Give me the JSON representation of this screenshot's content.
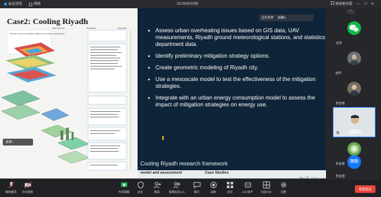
{
  "topbar": {
    "meeting_info": "会议详情",
    "meeting_id": "",
    "signal": "网络",
    "center_text": "20:56(40分钟)",
    "speaker_view": "演讲者布局",
    "window_controls": [
      "—",
      "☐",
      "✕"
    ]
  },
  "slide": {
    "title": "Case2: Cooling Riyadh",
    "framework_headers": [
      "Data Sources",
      "Procedure",
      "Approach"
    ],
    "framework_top_text": "Weather observa- locations stations anomalous temperature",
    "bullets": [
      "Assess urban overheating issues based on GIS data, UAV measurements, Riyadh ground meteorological stations, and statistics department data.",
      "Identify preliminary mitigation strategy options.",
      "Create geometric modeling of Riyadh city.",
      "Use a mesoscale model to test the effectiveness of the mitigation strategies.",
      "Integrate with an urban energy consumption model to assess the impact of mitigation strategies on energy use."
    ],
    "caption": "Cooling Riyadh research framework",
    "bottom_strip": [
      "model and assessment",
      "Case Studies"
    ],
    "screen_tag": [
      "正在共享",
      "屏幕1"
    ],
    "mini_label": "主讲..."
  },
  "watermark": {
    "line1": "激活 Window",
    "line2": "转到\"设置\"以激活 Windows。"
  },
  "participants": [
    {
      "name": "主持",
      "avatar": "wechat-icon",
      "color": "#11b84a"
    },
    {
      "name": "杨平",
      "avatar": "person-photo",
      "color": "#6d7277"
    },
    {
      "name": "参会者",
      "avatar": "person-photo",
      "color": "#7b6f63"
    },
    {
      "name": "我",
      "avatar": "camera-video",
      "color": "#dfe4e8",
      "active": true
    },
    {
      "name": "参会者",
      "avatar": "landscape-photo",
      "color": "#6aa84f"
    },
    {
      "name": "参会者",
      "avatar": "text-avatar",
      "color": "#1677ff",
      "text": "飘飘"
    }
  ],
  "toolbar": {
    "left": [
      {
        "label": "解除静音",
        "icon": "mic-icon"
      },
      {
        "label": "开启视频",
        "icon": "camera-icon"
      }
    ],
    "center": [
      {
        "label": "共享屏幕",
        "icon": "share-screen-icon",
        "accent": "#1fb35a"
      },
      {
        "label": "安全",
        "icon": "shield-icon"
      },
      {
        "label": "邀请",
        "icon": "invite-icon"
      },
      {
        "label": "管理成员(14)",
        "icon": "members-icon"
      },
      {
        "label": "聊天",
        "icon": "chat-icon"
      },
      {
        "label": "录制",
        "icon": "record-icon"
      },
      {
        "label": "应用",
        "icon": "apps-icon"
      },
      {
        "label": "AI小助手",
        "icon": "ai-icon"
      },
      {
        "label": "分组讨论",
        "icon": "breakout-icon"
      },
      {
        "label": "设置",
        "icon": "gear-icon"
      }
    ],
    "leave": "结束会议"
  }
}
